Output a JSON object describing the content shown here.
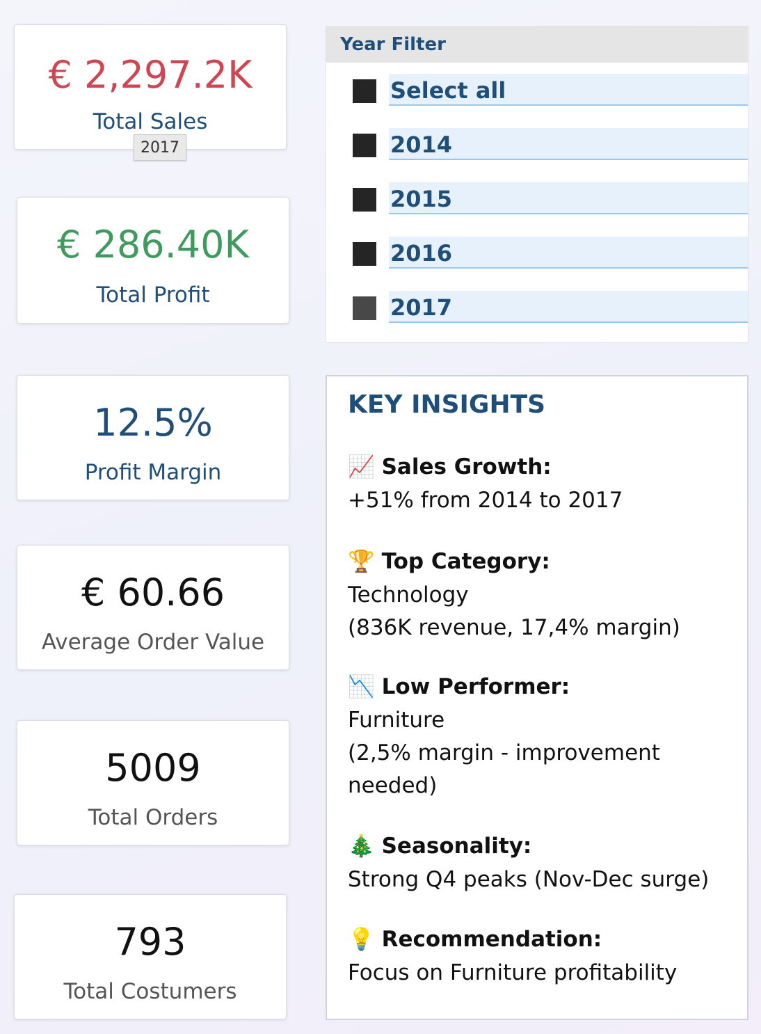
{
  "kpis": {
    "total_sales": {
      "value": "€ 2,297.2K",
      "label": "Total Sales",
      "color": "#d04552"
    },
    "total_profit": {
      "value": "€ 286.40K",
      "label": "Total Profit",
      "color": "#3f9a5e"
    },
    "profit_margin": {
      "value": "12.5%",
      "label": "Profit Margin",
      "color": "#1f4e79"
    },
    "avg_order_value": {
      "value": "€ 60.66",
      "label": "Average Order Value",
      "color": "#111111"
    },
    "total_orders": {
      "value": "5009",
      "label": "Total Orders",
      "color": "#111111"
    },
    "total_customers": {
      "value": "793",
      "label": "Total Costumers",
      "color": "#111111"
    }
  },
  "tooltip": {
    "text": "2017"
  },
  "year_filter": {
    "title": "Year Filter",
    "options": [
      "Select all",
      "2014",
      "2015",
      "2016",
      "2017"
    ]
  },
  "insights": {
    "title": "KEY INSIGHTS",
    "sales_growth": {
      "emoji": "📈",
      "heading": "Sales Growth:",
      "lines": [
        "+51% from 2014 to 2017"
      ]
    },
    "top_category": {
      "emoji": "🏆",
      "heading": "Top Category:",
      "lines": [
        "Technology",
        "(836K revenue, 17,4% margin)"
      ]
    },
    "low_performer": {
      "emoji": "📉",
      "heading": "Low Performer:",
      "lines": [
        "Furniture",
        "(2,5% margin - improvement",
        "needed)"
      ]
    },
    "seasonality": {
      "emoji": "🎄",
      "heading": "Seasonality:",
      "lines": [
        "Strong Q4 peaks (Nov-Dec surge)"
      ]
    },
    "recommendation": {
      "emoji": "💡",
      "heading": "Recommendation:",
      "lines": [
        "Focus on Furniture profitability"
      ]
    }
  }
}
